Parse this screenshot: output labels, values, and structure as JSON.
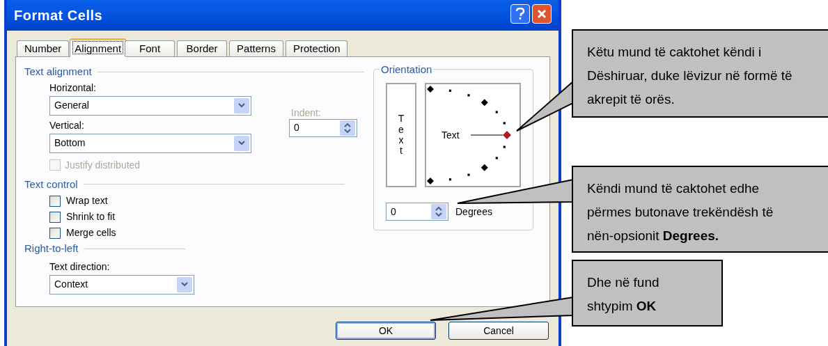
{
  "window": {
    "title": "Format Cells"
  },
  "tabs": [
    {
      "label": "Number",
      "selected": false
    },
    {
      "label": "Alignment",
      "selected": true
    },
    {
      "label": "Font",
      "selected": false
    },
    {
      "label": "Border",
      "selected": false
    },
    {
      "label": "Patterns",
      "selected": false
    },
    {
      "label": "Protection",
      "selected": false
    }
  ],
  "text_alignment": {
    "heading": "Text alignment",
    "horizontal": {
      "label": "Horizontal:",
      "value": "General"
    },
    "vertical": {
      "label": "Vertical:",
      "value": "Bottom"
    },
    "indent": {
      "label": "Indent:",
      "value": "0",
      "disabled": true
    },
    "justify_distributed": {
      "label": "Justify distributed",
      "checked": false,
      "disabled": true
    }
  },
  "text_control": {
    "heading": "Text control",
    "options": [
      {
        "label": "Wrap text",
        "checked": false
      },
      {
        "label": "Shrink to fit",
        "checked": false
      },
      {
        "label": "Merge cells",
        "checked": false
      }
    ]
  },
  "right_to_left": {
    "heading": "Right-to-left",
    "text_direction": {
      "label": "Text direction:",
      "value": "Context"
    }
  },
  "orientation": {
    "heading": "Orientation",
    "vertical_text": "Text",
    "dial_text": "Text",
    "degrees": {
      "value": "0",
      "label": "Degrees"
    }
  },
  "buttons": [
    {
      "label": "OK",
      "default": true
    },
    {
      "label": "Cancel",
      "default": false
    }
  ],
  "callouts": [
    {
      "text": "Këtu mund të caktohet këndi i Dëshiruar, duke lëvizur në formë të akrepit të orës."
    },
    {
      "text": "Këndi mund të caktohet edhe përmes butonave trekëndësh të nën-opsionit **Degrees.**"
    },
    {
      "text": "Dhe në fund shtypim **OK**"
    }
  ]
}
